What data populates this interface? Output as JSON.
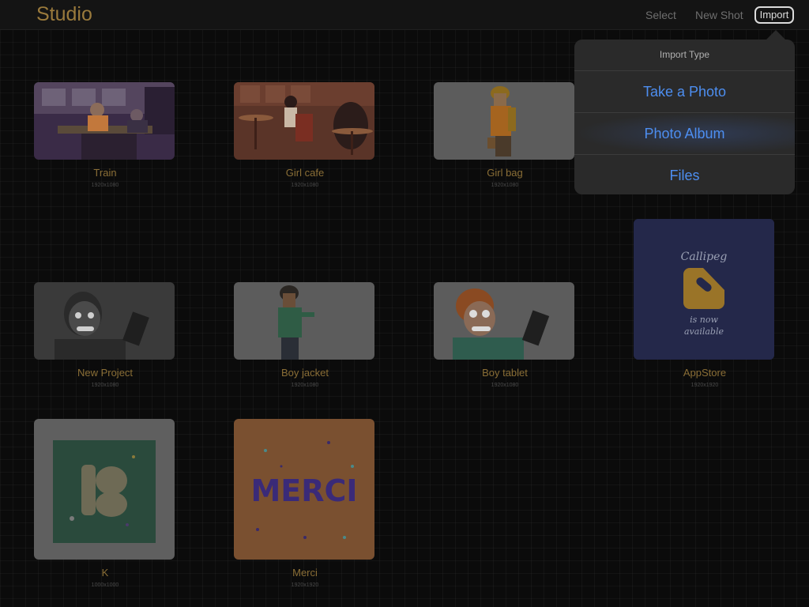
{
  "app": {
    "title": "Studio"
  },
  "toolbar": {
    "select_label": "Select",
    "new_shot_label": "New Shot",
    "import_label": "Import"
  },
  "import_popover": {
    "header": "Import Type",
    "options": [
      "Take a Photo",
      "Photo Album",
      "Files"
    ]
  },
  "projects": [
    {
      "title": "Train",
      "size": "1920x1080"
    },
    {
      "title": "Girl cafe",
      "size": "1920x1080"
    },
    {
      "title": "Girl bag",
      "size": "1920x1080"
    },
    {
      "title": "New Project",
      "size": "1920x1080"
    },
    {
      "title": "Boy jacket",
      "size": "1920x1080"
    },
    {
      "title": "Boy tablet",
      "size": "1920x1080"
    },
    {
      "title": "AppStore",
      "size": "1920x1920"
    },
    {
      "title": "K",
      "size": "1000x1000"
    },
    {
      "title": "Merci",
      "size": "1920x1920"
    }
  ],
  "thumb_text": {
    "appstore_brand": "Callipeg",
    "appstore_line1": "is now",
    "appstore_line2": "available",
    "merci_word": "MERCI"
  },
  "colors": {
    "accent": "#9a7a3c",
    "link": "#4d8ef0",
    "background": "#0b0b0b"
  }
}
